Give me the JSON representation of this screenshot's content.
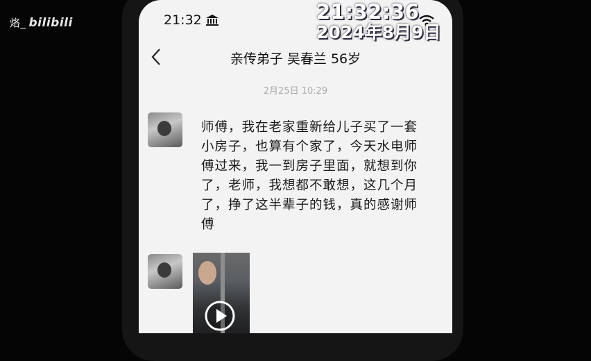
{
  "watermark": {
    "name": "烙_",
    "logo": "bilibili"
  },
  "status_bar": {
    "time": "21:32"
  },
  "overlay": {
    "time": "21:32:36",
    "date": "2024年8月9日"
  },
  "chat": {
    "title": "亲传弟子 吴春兰 56岁",
    "timestamp": "2月25日 10:29",
    "message": "师傅，我在老家重新给儿子买了一套小房子，也算有个家了，今天水电师傅过来，我一到房子里面，就想到你了，老师，我想都不敢想，这几个月了，挣了这半辈子的钱，真的感谢师傅"
  },
  "icons": [
    "bank-icon",
    "wifi-icon",
    "back-icon",
    "play-icon"
  ],
  "colors": {
    "screen_bg": "#f3f3f3",
    "outer_bg": "#050505",
    "timestamp": "#aaaaaa"
  }
}
